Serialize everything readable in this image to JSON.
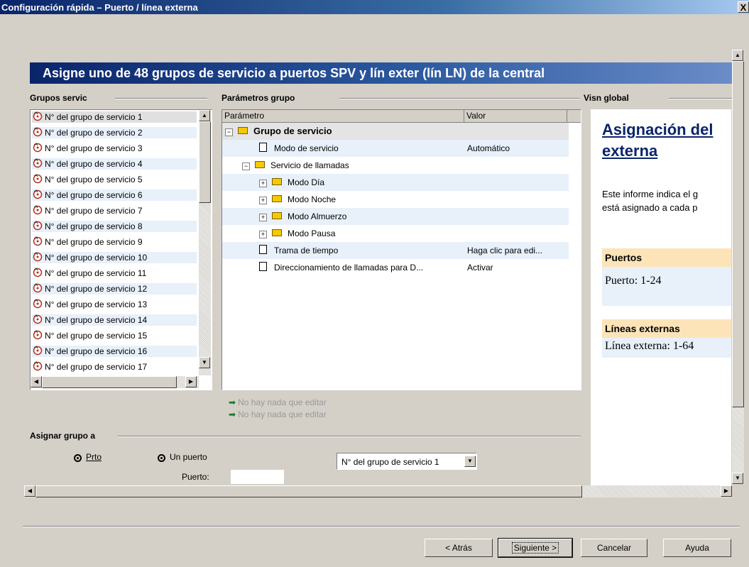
{
  "window": {
    "title": "Configuración rápida – Puerto / línea externa",
    "close_label": "X"
  },
  "banner": {
    "title": "Asigne uno de 48 grupos de servicio a puertos SPV y lín exter (lín LN) de la central"
  },
  "groups_panel": {
    "title": "Grupos servic",
    "items": [
      "N° del grupo de servicio 1",
      "N° del grupo de servicio 2",
      "N° del grupo de servicio 3",
      "N° del grupo de servicio 4",
      "N° del grupo de servicio 5",
      "N° del grupo de servicio 6",
      "N° del grupo de servicio 7",
      "N° del grupo de servicio 8",
      "N° del grupo de servicio 9",
      "N° del grupo de servicio 10",
      "N° del grupo de servicio 11",
      "N° del grupo de servicio 12",
      "N° del grupo de servicio 13",
      "N° del grupo de servicio 14",
      "N° del grupo de servicio 15",
      "N° del grupo de servicio 16",
      "N° del grupo de servicio 17"
    ],
    "item_icon": "service-group-icon"
  },
  "params_panel": {
    "title": "Parámetros grupo",
    "columns": [
      "Parámetro",
      "Valor"
    ],
    "rows": [
      {
        "name": "Grupo de servicio",
        "value": "",
        "type": "folder",
        "expander": "−",
        "bold": true
      },
      {
        "name": "Modo de servicio",
        "value": "Automático",
        "type": "doc",
        "expander": ""
      },
      {
        "name": "Servicio de llamadas",
        "value": "",
        "type": "folder",
        "expander": "−"
      },
      {
        "name": "Modo Día",
        "value": "",
        "type": "folder",
        "expander": "+"
      },
      {
        "name": "Modo Noche",
        "value": "",
        "type": "folder",
        "expander": "+"
      },
      {
        "name": "Modo Almuerzo",
        "value": "",
        "type": "folder",
        "expander": "+"
      },
      {
        "name": "Modo Pausa",
        "value": "",
        "type": "folder",
        "expander": "+"
      },
      {
        "name": "Trama de tiempo",
        "value": "Haga clic para edi...",
        "type": "doc",
        "expander": ""
      },
      {
        "name": "Direccionamiento de llamadas para D...",
        "value": "Activar",
        "type": "doc",
        "expander": ""
      }
    ],
    "notes": [
      "No hay nada que editar",
      "No hay nada que editar"
    ]
  },
  "overview_panel": {
    "title": "Visn global",
    "heading_line1": "Asignación del",
    "heading_line2": "externa",
    "text_line1": "Este informe indica el g",
    "text_line2": "está asignado a cada p",
    "ports_header": "Puertos",
    "ports_value": "Puerto: 1-24",
    "lines_header": "Líneas externas",
    "lines_value": "Línea externa: 1-64"
  },
  "assign": {
    "title": "Asignar grupo a",
    "option1": "Prto",
    "option2": "Un puerto",
    "port_label": "Puerto:",
    "port_value": "",
    "group_select": "N° del grupo de servicio 1"
  },
  "buttons": {
    "back": "< Atrás",
    "next": "Siguiente >",
    "cancel": "Cancelar",
    "help": "Ayuda"
  },
  "colors": {
    "banner": "#0a246a",
    "row_alt": "#e8f0fa",
    "section_header": "#fce4b8",
    "link": "#0a246a"
  }
}
